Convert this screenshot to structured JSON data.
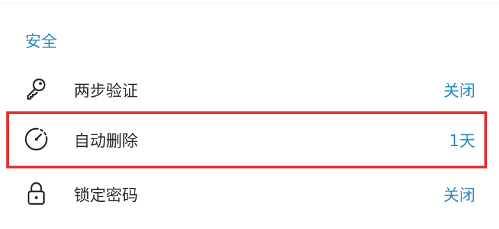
{
  "section": {
    "title": "安全"
  },
  "rows": [
    {
      "icon": "key-icon",
      "label": "两步验证",
      "value": "关闭"
    },
    {
      "icon": "timer-icon",
      "label": "自动删除",
      "value": "1天"
    },
    {
      "icon": "lock-icon",
      "label": "锁定密码",
      "value": "关闭"
    }
  ],
  "colors": {
    "accent": "#2a8bbd",
    "highlight": "#e03131",
    "text": "#2b2b2b"
  }
}
